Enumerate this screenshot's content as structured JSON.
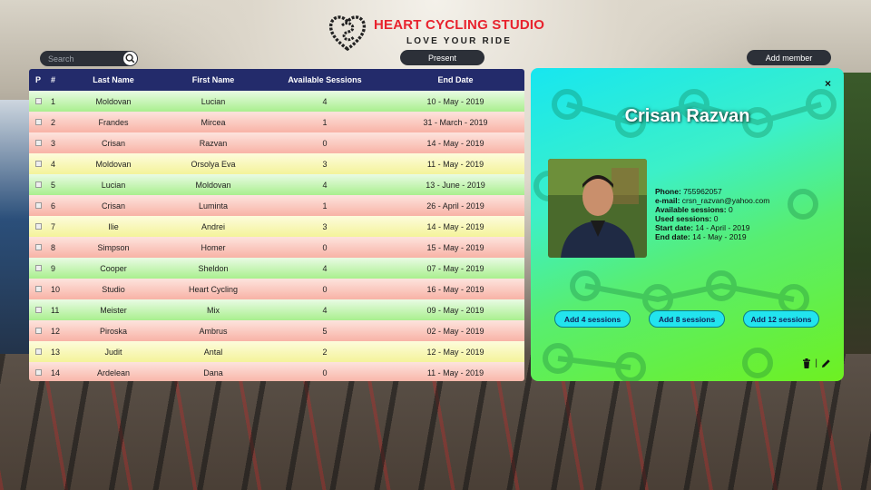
{
  "brand": {
    "title": "HEART CYCLING STUDIO",
    "tagline": "LOVE YOUR RIDE",
    "accent": "#e8232e"
  },
  "search": {
    "placeholder": "Search",
    "value": ""
  },
  "toolbar": {
    "present_label": "Present",
    "add_member_label": "Add member"
  },
  "table": {
    "columns": [
      "P",
      "#",
      "Last Name",
      "First Name",
      "Available Sessions",
      "End Date"
    ],
    "rows": [
      {
        "num": "1",
        "last": "Moldovan",
        "first": "Lucian",
        "sessions": "4",
        "end": "10 - May - 2019",
        "status": "green"
      },
      {
        "num": "2",
        "last": "Frandes",
        "first": "Mircea",
        "sessions": "1",
        "end": "31 - March - 2019",
        "status": "red"
      },
      {
        "num": "3",
        "last": "Crisan",
        "first": "Razvan",
        "sessions": "0",
        "end": "14 - May - 2019",
        "status": "red"
      },
      {
        "num": "4",
        "last": "Moldovan",
        "first": "Orsolya Eva",
        "sessions": "3",
        "end": "11 - May - 2019",
        "status": "yellow"
      },
      {
        "num": "5",
        "last": "Lucian",
        "first": "Moldovan",
        "sessions": "4",
        "end": "13 - June - 2019",
        "status": "green"
      },
      {
        "num": "6",
        "last": "Crisan",
        "first": "Luminta",
        "sessions": "1",
        "end": "26 - April - 2019",
        "status": "red"
      },
      {
        "num": "7",
        "last": "Ilie",
        "first": "Andrei",
        "sessions": "3",
        "end": "14 - May - 2019",
        "status": "yellow"
      },
      {
        "num": "8",
        "last": "Simpson",
        "first": "Homer",
        "sessions": "0",
        "end": "15 - May - 2019",
        "status": "red"
      },
      {
        "num": "9",
        "last": "Cooper",
        "first": "Sheldon",
        "sessions": "4",
        "end": "07 - May - 2019",
        "status": "green"
      },
      {
        "num": "10",
        "last": "Studio",
        "first": "Heart Cycling",
        "sessions": "0",
        "end": "16 - May - 2019",
        "status": "red"
      },
      {
        "num": "11",
        "last": "Meister",
        "first": "Mix",
        "sessions": "4",
        "end": "09 - May - 2019",
        "status": "green"
      },
      {
        "num": "12",
        "last": "Piroska",
        "first": "Ambrus",
        "sessions": "5",
        "end": "02 - May - 2019",
        "status": "red"
      },
      {
        "num": "13",
        "last": "Judit",
        "first": "Antal",
        "sessions": "2",
        "end": "12 - May - 2019",
        "status": "yellow"
      },
      {
        "num": "14",
        "last": "Ardelean",
        "first": "Dana",
        "sessions": "0",
        "end": "11 - May - 2019",
        "status": "red"
      }
    ]
  },
  "member": {
    "name": "Crisan Razvan",
    "close_label": "×",
    "phone_label": "Phone:",
    "phone": " 755962057",
    "email_label": "e-mail:",
    "email": " crsn_razvan@yahoo.com",
    "available_label": "Available sessions:",
    "available": " 0",
    "used_label": "Used sessions:",
    "used": " 0",
    "start_label": "Start date:",
    "start": " 14 - April - 2019",
    "end_label": "End date:",
    "end": " 14 - May - 2019",
    "buttons": [
      "Add 4 sessions",
      "Add 8 sessions",
      "Add 12 sessions"
    ],
    "separator": "|"
  },
  "status_colors": {
    "green": "#a9ef8e",
    "red": "#f8b3a6",
    "yellow": "#f4f39a"
  },
  "icons": [
    "heart-chain-logo",
    "search-icon",
    "trash-icon",
    "pencil-icon"
  ]
}
